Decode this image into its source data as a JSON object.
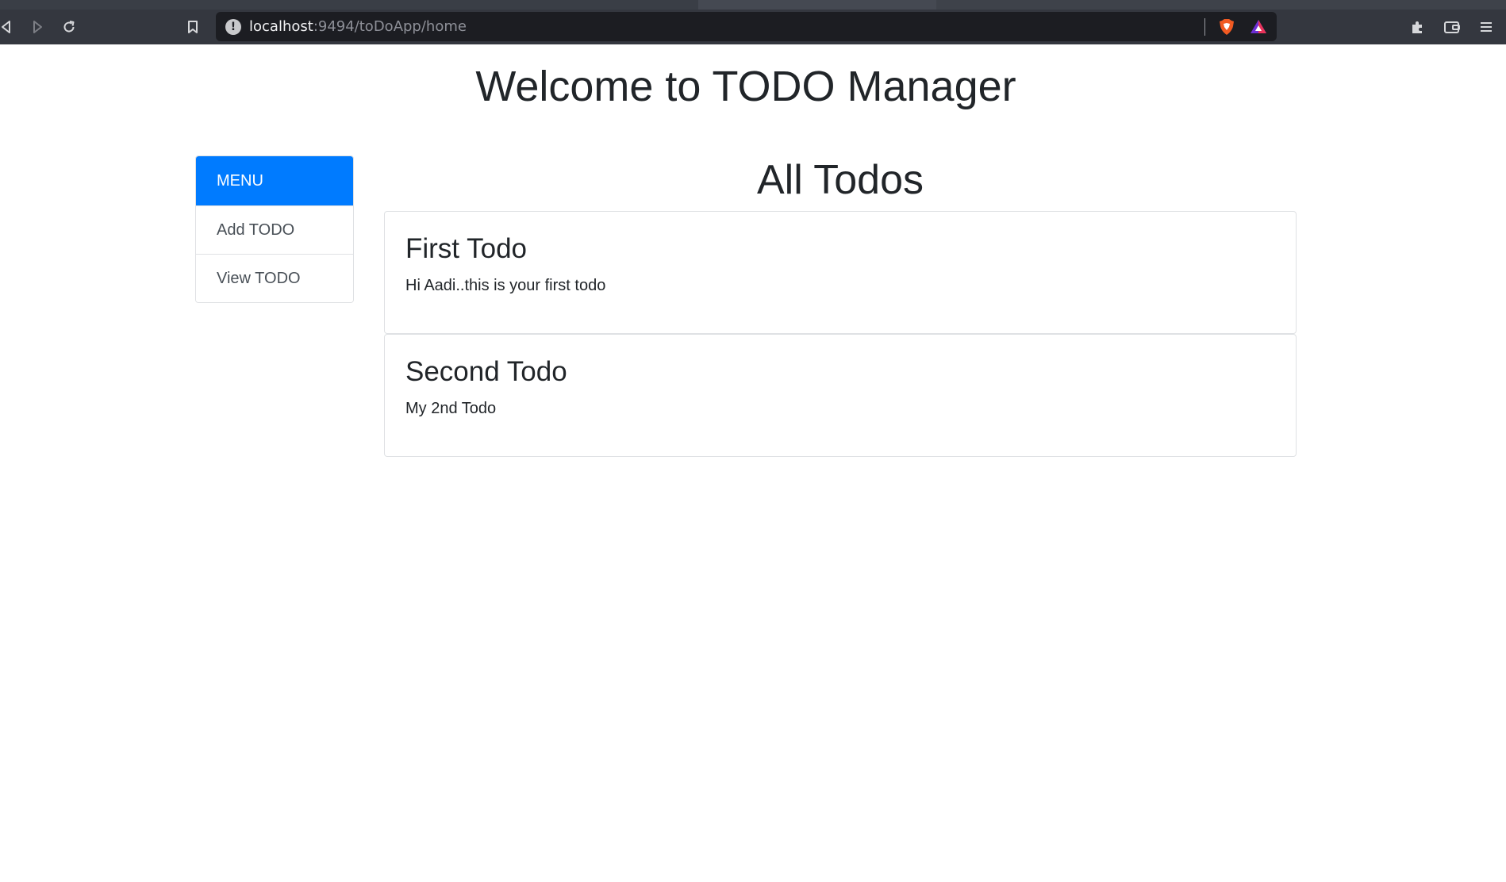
{
  "browser": {
    "url_host": "localhost",
    "url_path": ":9494/toDoApp/home",
    "colors": {
      "chrome": "#34373f",
      "urlbar": "#1c1d22"
    },
    "icons": [
      "back-icon",
      "forward-icon",
      "reload-icon",
      "bookmark-icon",
      "site-info-icon",
      "brave-shield-icon",
      "brave-rewards-icon",
      "extensions-icon",
      "wallet-icon",
      "menu-icon"
    ]
  },
  "page": {
    "title": "Welcome to TODO Manager",
    "menu": {
      "header": "MENU",
      "items": [
        "Add TODO",
        "View TODO"
      ],
      "accent": "#007bff"
    },
    "section_title": "All Todos",
    "todos": [
      {
        "title": "First Todo",
        "content": "Hi Aadi..this is your first todo"
      },
      {
        "title": "Second Todo",
        "content": "My 2nd Todo"
      }
    ]
  }
}
